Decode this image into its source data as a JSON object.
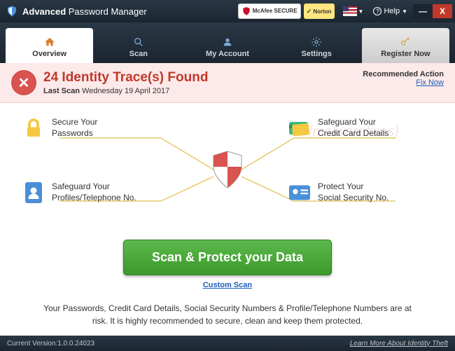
{
  "titlebar": {
    "app_bold": "Advanced",
    "app_rest": " Password Manager",
    "badge_mcafee": "McAfee SECURE",
    "badge_norton": "Norton",
    "help": "Help",
    "minimize": "—",
    "close": "X"
  },
  "tabs": {
    "overview": "Overview",
    "scan": "Scan",
    "account": "My Account",
    "settings": "Settings",
    "register": "Register Now"
  },
  "alert": {
    "badge": "✕",
    "headline": "24 Identity Trace(s) Found",
    "last_scan_label": "Last Scan",
    "last_scan_value": " Wednesday 19 April 2017",
    "recommended": "Recommended Action",
    "fix": "Fix Now"
  },
  "watermark": "{malwarefixes}",
  "features": {
    "tl": "Secure Your\nPasswords",
    "tr": "Safeguard Your\nCredit Card Details",
    "bl": "Safeguard Your\nProfiles/Telephone No.",
    "br": "Protect Your\nSocial Security No."
  },
  "cta": {
    "button": "Scan & Protect your Data",
    "custom": "Custom Scan"
  },
  "desc": "Your Passwords, Credit Card Details, Social Security Numbers & Profile/Telephone Numbers are at risk. It is highly recommended to secure, clean and keep them protected.",
  "footer": {
    "version": "Current Version:1.0.0.24023",
    "learn": "Learn More About Identity Theft"
  }
}
